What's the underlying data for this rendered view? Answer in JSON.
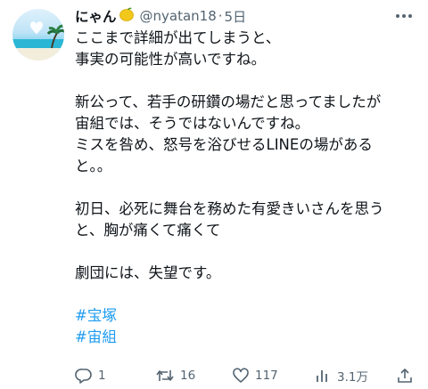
{
  "tweet": {
    "display_name": "にゃん",
    "handle": "@nyatan18",
    "separator": "·",
    "time": "5日",
    "body_lines": [
      "ここまで詳細が出てしまうと、",
      "事実の可能性が高いですね。",
      "",
      "新公って、若手の研鑽の場だと思ってましたが",
      "宙組では、そうではないんですね。",
      "ミスを咎め、怒号を浴びせるLINEの場がある",
      "と。。",
      "",
      "初日、必死に舞台を務めた有愛きいさんを思う",
      "と、胸が痛くて痛くて",
      "",
      "劇団には、失望です。",
      ""
    ],
    "hashtags": [
      "#宝塚",
      "#宙組"
    ]
  },
  "actions": {
    "reply_count": "1",
    "retweet_count": "16",
    "like_count": "117",
    "view_count": "3.1万"
  },
  "icons": {
    "avatar": "avatar-beach-heart-cloud",
    "name_emoji": "lemon-emoji",
    "more": "more-dots-icon",
    "reply": "reply-icon",
    "retweet": "retweet-icon",
    "like": "heart-icon",
    "views": "views-bar-chart-icon",
    "share": "share-icon"
  },
  "colors": {
    "text": "#0f1419",
    "secondary": "#536471",
    "hashtag": "#1d9bf0"
  }
}
